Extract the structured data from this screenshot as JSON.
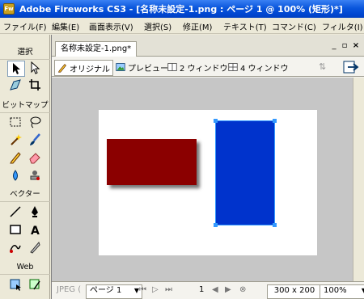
{
  "window": {
    "title": "Adobe Fireworks CS3 - [名称未設定-1.png : ページ 1 @ 100% (矩形)*]",
    "app_icon_text": "Fw"
  },
  "menu": [
    "ファイル(F)",
    "編集(E)",
    "画面表示(V)",
    "選択(S)",
    "修正(M)",
    "テキスト(T)",
    "コマンド(C)",
    "フィルタ(I)"
  ],
  "tools": {
    "sections": {
      "select": "選択",
      "bitmap": "ビットマップ",
      "vector": "ベクター",
      "web": "Web"
    }
  },
  "document": {
    "tab_label": "名称未設定-1.png*",
    "views": {
      "original": "オリジナル",
      "preview": "プレビュー",
      "two_up": "2 ウィンドウ",
      "four_up": "4 ウィンドウ"
    },
    "shapes": {
      "rect_red_color": "#8b0000",
      "rect_blue_color": "#0033cc"
    }
  },
  "status": {
    "format": "JPEG (",
    "page": "ページ 1",
    "frame": "1",
    "dimensions": "300 x 200",
    "zoom": "100%"
  },
  "colors": {
    "titlebar": "#0a56dc",
    "chrome": "#ece9d8",
    "canvas_bg": "#c6c6c6",
    "selection_handle": "#3399ff"
  }
}
